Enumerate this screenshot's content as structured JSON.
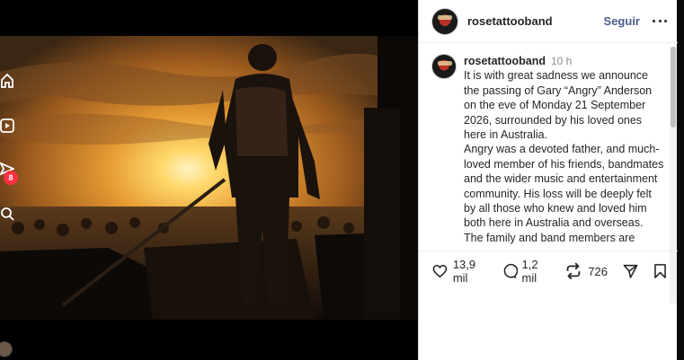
{
  "post": {
    "username": "rosetattooband",
    "follow_label": "Seguir",
    "more_icon": "more-horizontal-icon"
  },
  "caption": {
    "username": "rosetattooband",
    "time": "10 h",
    "text": "It is with great sadness we announce the passing of Gary “Angry” Anderson on the eve of Monday 21 September 2026, surrounded by his loved ones here in Australia.\nAngry was a devoted father, and much-loved member of his friends, bandmates and the wider music and entertainment community. His loss will be deeply felt by all those who knew and loved him both here in Australia and overseas.\nThe family and band members are"
  },
  "actions": {
    "likes": "13,9 mil",
    "comments": "1,2 mil",
    "reposts": "726"
  },
  "left_rail": {
    "notification_badge": "8"
  },
  "colors": {
    "accent_link": "#4a5d8f",
    "badge": "#ff3040",
    "sunset_core": "#ffd86b",
    "sunset_sky": "#c8731f"
  }
}
